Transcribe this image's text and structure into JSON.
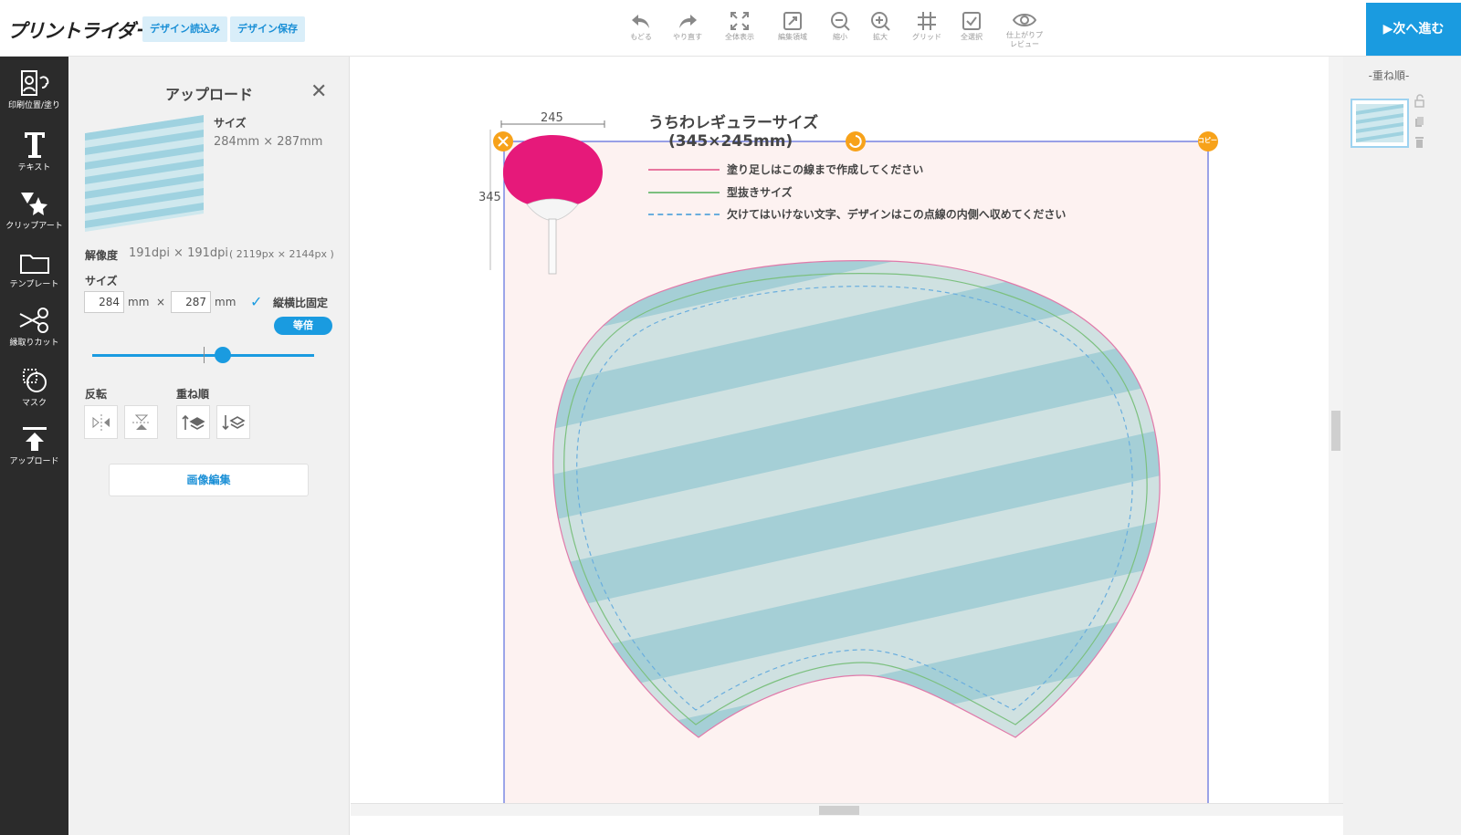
{
  "header": {
    "logo": "プリントライダー",
    "load_design": "デザイン読込み",
    "save_design": "デザイン保存",
    "tools": [
      {
        "label": "もどる",
        "icon": "undo-icon"
      },
      {
        "label": "やり直す",
        "icon": "redo-icon"
      },
      {
        "label": "全体表示",
        "icon": "fit-all-icon"
      },
      {
        "label": "編集領域",
        "icon": "edit-area-icon"
      },
      {
        "label": "縮小",
        "icon": "zoom-out-icon"
      },
      {
        "label": "拡大",
        "icon": "zoom-in-icon"
      },
      {
        "label": "グリッド",
        "icon": "grid-icon"
      },
      {
        "label": "全選択",
        "icon": "select-all-icon"
      },
      {
        "label": "仕上がりプレビュー",
        "icon": "eye-icon"
      }
    ],
    "next": "▶次へ進む"
  },
  "sidebar": {
    "items": [
      {
        "label": "印刷位置/塗り",
        "icon": "print-position-icon"
      },
      {
        "label": "テキスト",
        "icon": "text-icon"
      },
      {
        "label": "クリップアート",
        "icon": "clipart-icon"
      },
      {
        "label": "テンプレート",
        "icon": "folder-icon"
      },
      {
        "label": "縁取りカット",
        "icon": "scissors-icon"
      },
      {
        "label": "マスク",
        "icon": "mask-icon"
      },
      {
        "label": "アップロード",
        "icon": "upload-icon"
      }
    ]
  },
  "panel": {
    "title": "アップロード",
    "size_label": "サイズ",
    "size_value": "284mm × 287mm",
    "resolution_label": "解像度",
    "resolution_value": "191dpi × 191dpi",
    "resolution_px": "( 2119px × 2144px )",
    "size_section": "サイズ",
    "width": "284",
    "height": "287",
    "unit": "mm",
    "times": "×",
    "keep_ratio": "縦横比固定",
    "equal": "等倍",
    "slider_level": 0.58,
    "flip_label": "反転",
    "order_label": "重ね順",
    "edit_image": "画像編集"
  },
  "canvas": {
    "title_line1": "うちわレギュラーサイズ",
    "title_line2": "(345×245mm)",
    "dim_width": "245",
    "dim_height": "345",
    "legend": [
      {
        "text": "塗り足しはこの線まで作成してください",
        "color": "#e8779f",
        "style": "solid"
      },
      {
        "text": "型抜きサイズ",
        "color": "#7cc07f",
        "style": "solid"
      },
      {
        "text": "欠けてはいけない文字、デザインはこの点線の内側へ収めてください",
        "color": "#6aaede",
        "style": "dashed"
      }
    ],
    "copy_label": "コピー",
    "colors": {
      "pink": "#e6197a",
      "handle": "#f7a21a",
      "frame": "#5b6fe0",
      "stripe_dark": "#a5cfd6",
      "stripe_light": "#cfe1e1"
    }
  },
  "right_panel": {
    "title": "-重ね順-"
  }
}
